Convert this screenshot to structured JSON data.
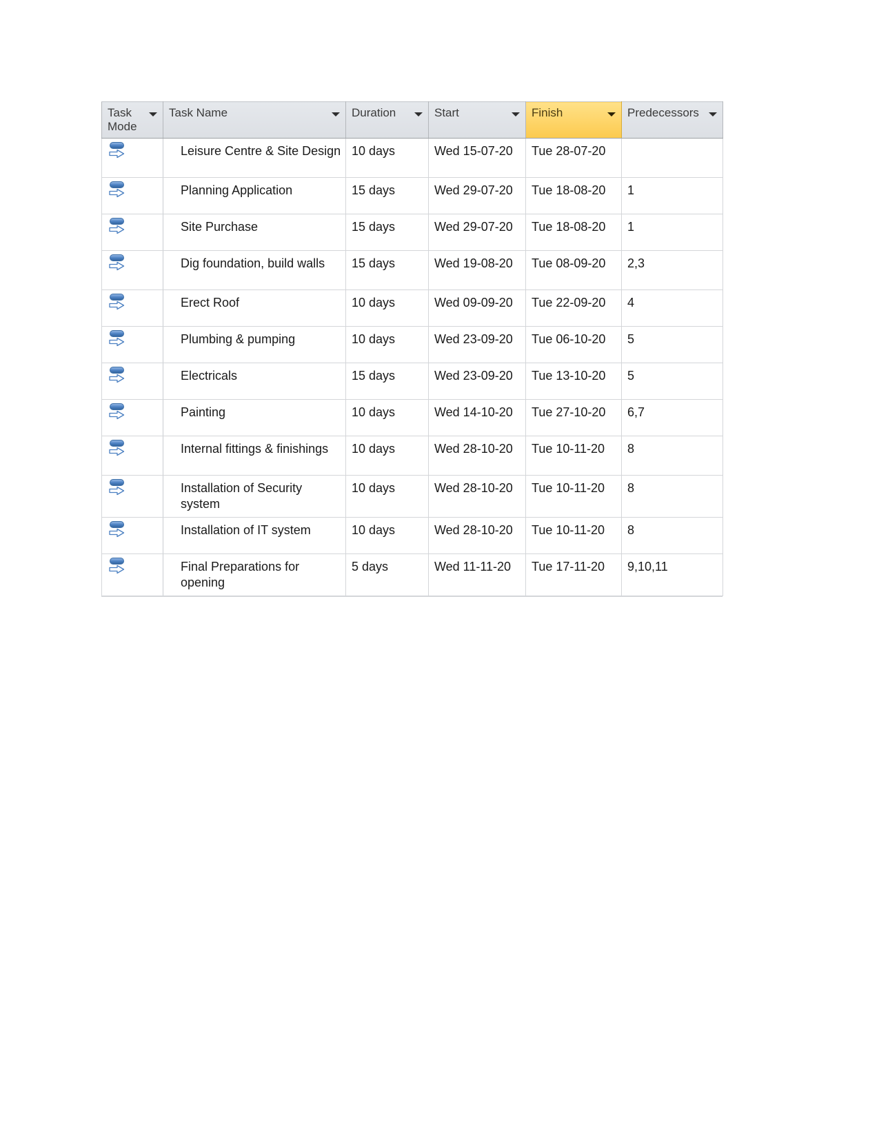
{
  "table": {
    "name": "project-task-table",
    "columns": [
      {
        "key": "task_mode",
        "label": "Task Mode",
        "highlighted": false,
        "icon": "chevron-down-icon"
      },
      {
        "key": "task_name",
        "label": "Task Name",
        "highlighted": false,
        "icon": "chevron-down-icon"
      },
      {
        "key": "duration",
        "label": "Duration",
        "highlighted": false,
        "icon": "chevron-down-icon"
      },
      {
        "key": "start",
        "label": "Start",
        "highlighted": false,
        "icon": "chevron-down-icon"
      },
      {
        "key": "finish",
        "label": "Finish",
        "highlighted": true,
        "icon": "chevron-down-icon"
      },
      {
        "key": "predecessors",
        "label": "Predecessors",
        "highlighted": false,
        "icon": "chevron-down-icon"
      }
    ],
    "header_highlight_color": "#fdd66a",
    "header_background_color": "#dfe3e8",
    "task_mode_icon": "manually-scheduled-icon",
    "rows": [
      {
        "task_name": "Leisure Centre & Site Design",
        "duration": "10 days",
        "start": "Wed 15-07-20",
        "finish": "Tue 28-07-20",
        "predecessors": ""
      },
      {
        "task_name": "Planning Application",
        "duration": "15 days",
        "start": "Wed 29-07-20",
        "finish": "Tue 18-08-20",
        "predecessors": "1"
      },
      {
        "task_name": "Site Purchase",
        "duration": "15 days",
        "start": "Wed 29-07-20",
        "finish": "Tue 18-08-20",
        "predecessors": "1"
      },
      {
        "task_name": "Dig foundation, build walls",
        "duration": "15 days",
        "start": "Wed 19-08-20",
        "finish": "Tue 08-09-20",
        "predecessors": "2,3"
      },
      {
        "task_name": "Erect Roof",
        "duration": "10 days",
        "start": "Wed 09-09-20",
        "finish": "Tue 22-09-20",
        "predecessors": "4"
      },
      {
        "task_name": "Plumbing & pumping",
        "duration": "10 days",
        "start": "Wed 23-09-20",
        "finish": "Tue 06-10-20",
        "predecessors": "5"
      },
      {
        "task_name": "Electricals",
        "duration": "15 days",
        "start": "Wed 23-09-20",
        "finish": "Tue 13-10-20",
        "predecessors": "5"
      },
      {
        "task_name": "Painting",
        "duration": "10 days",
        "start": "Wed 14-10-20",
        "finish": "Tue 27-10-20",
        "predecessors": "6,7"
      },
      {
        "task_name": "Internal fittings & finishings",
        "duration": "10 days",
        "start": "Wed 28-10-20",
        "finish": "Tue 10-11-20",
        "predecessors": "8"
      },
      {
        "task_name": "Installation of Security system",
        "duration": "10 days",
        "start": "Wed 28-10-20",
        "finish": "Tue 10-11-20",
        "predecessors": "8"
      },
      {
        "task_name": "Installation of IT system",
        "duration": "10 days",
        "start": "Wed 28-10-20",
        "finish": "Tue 10-11-20",
        "predecessors": "8"
      },
      {
        "task_name": "Final Preparations for opening",
        "duration": "5 days",
        "start": "Wed 11-11-20",
        "finish": "Tue 17-11-20",
        "predecessors": "9,10,11"
      }
    ]
  }
}
